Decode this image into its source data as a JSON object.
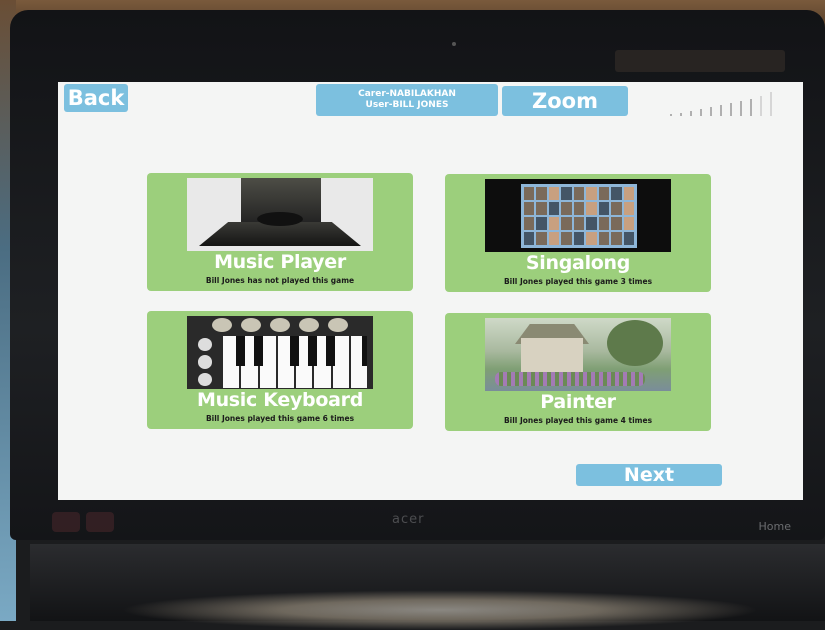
{
  "header": {
    "back_label": "Back",
    "carer_line": "Carer-NABILAKHAN",
    "user_line": "User-BILL JONES",
    "zoom_label": "Zoom"
  },
  "volume": {
    "level_bars": 9,
    "total_bars": 11
  },
  "games": [
    {
      "title": "Music Player",
      "status": "Bill Jones has not played this game",
      "image": "record-player-image"
    },
    {
      "title": "Singalong",
      "status": "Bill Jones played this game 3 times",
      "image": "photo-grid-image"
    },
    {
      "title": "Music Keyboard",
      "status": "Bill Jones played this game 6 times",
      "image": "piano-keyboard-image"
    },
    {
      "title": "Painter",
      "status": "Bill Jones played this game 4 times",
      "image": "cottage-painting-image"
    }
  ],
  "footer": {
    "next_label": "Next"
  },
  "device": {
    "home_label": "Home"
  },
  "colors": {
    "tile_green": "#9ccf7c",
    "button_blue": "#7cc0df",
    "screen_bg": "#f4f5f4"
  }
}
